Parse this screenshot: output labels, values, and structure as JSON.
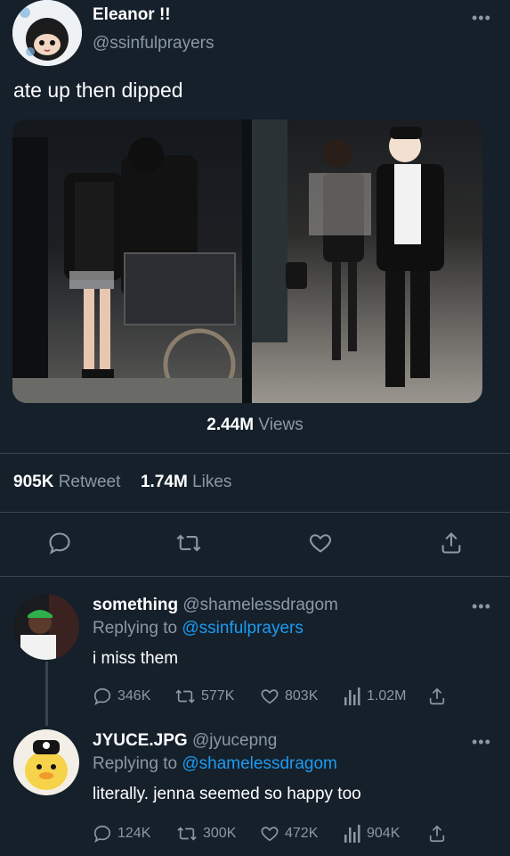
{
  "main_tweet": {
    "display_name": "Eleanor !!",
    "handle": "@ssinfulprayers",
    "text": "ate up then dipped",
    "views_count": "2.44M",
    "views_label": "Views",
    "retweets_count": "905K",
    "retweets_label": "Retweet",
    "likes_count": "1.74M",
    "likes_label": "Likes",
    "more_label": "•••"
  },
  "replies": [
    {
      "display_name": "something",
      "handle": "@shamelessdragom",
      "replying_label": "Replying to",
      "replying_to": "@ssinfulprayers",
      "text": "i miss them",
      "replies": "346K",
      "retweets": "577K",
      "likes": "803K",
      "views": "1.02M",
      "more_label": "•••"
    },
    {
      "display_name": "JYUCE.JPG",
      "handle": "@jyucepng",
      "replying_label": "Replying to",
      "replying_to": "@shamelessdragom",
      "text": "literally. jenna seemed so happy too",
      "replies": "124K",
      "retweets": "300K",
      "likes": "472K",
      "views": "904K",
      "more_label": "•••"
    }
  ],
  "colors": {
    "background": "#15202b",
    "muted": "#8b98a5",
    "link": "#1d9bf0",
    "divider": "#38444d"
  }
}
